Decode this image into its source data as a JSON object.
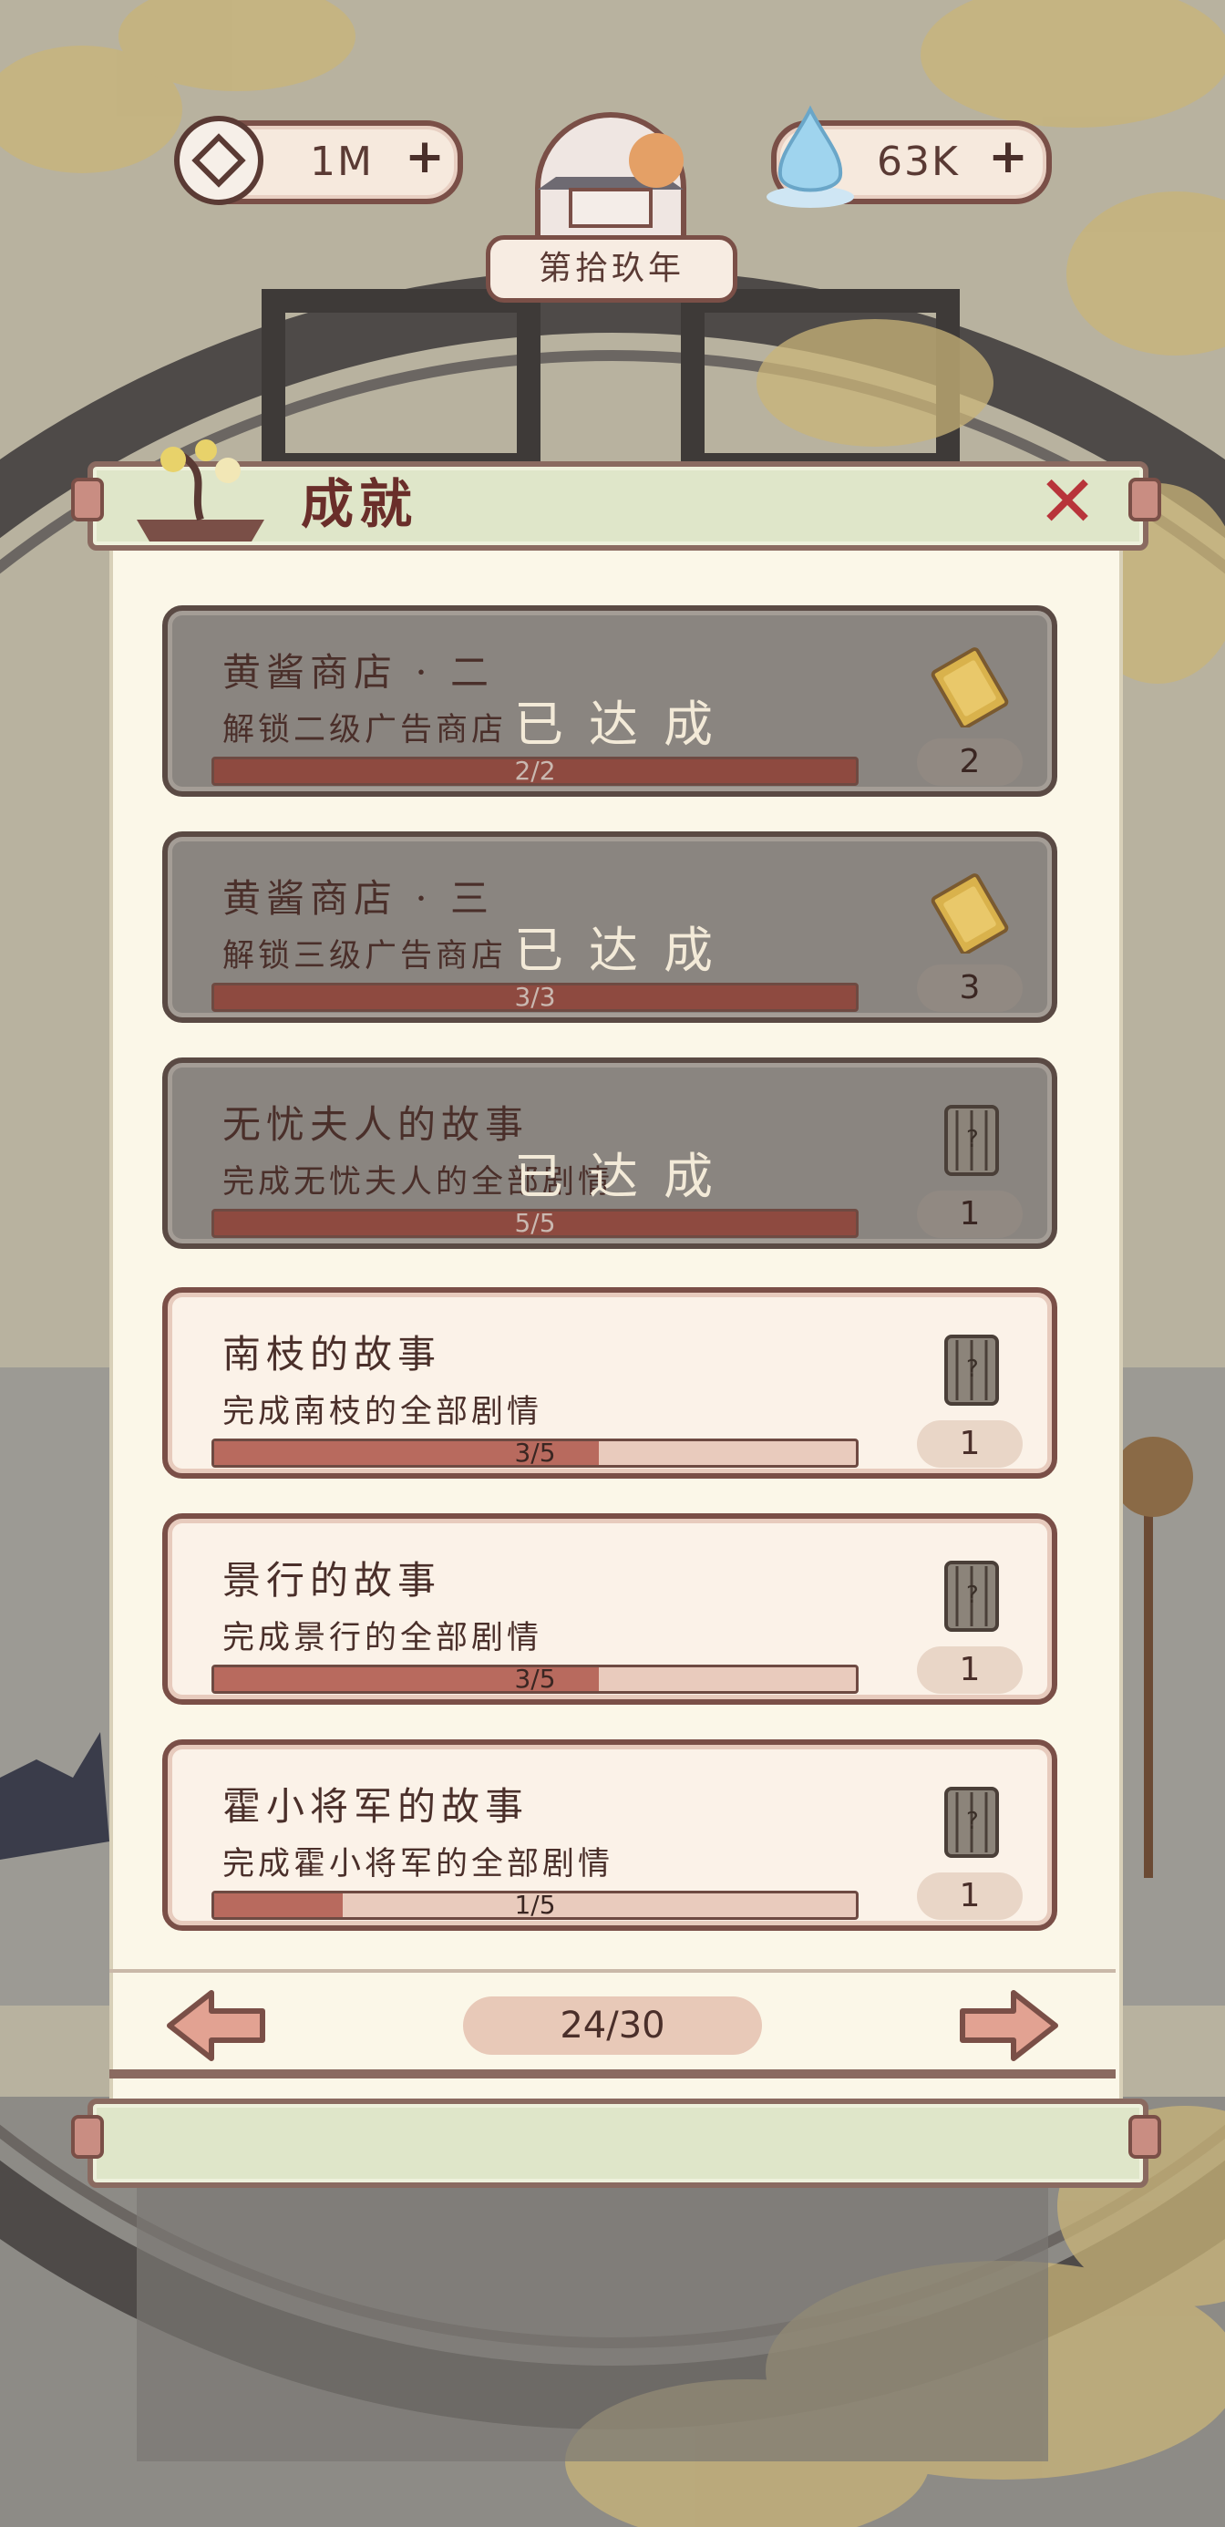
{
  "hud": {
    "coins": "1M",
    "water": "63K",
    "year": "第拾玖年"
  },
  "panel": {
    "title": "成就"
  },
  "achievements": [
    {
      "name": "黄酱商店 · 二",
      "desc": "解锁二级广告商店",
      "progress": "2/2",
      "fraction": 1.0,
      "completed": true,
      "completed_label": "已达成",
      "reward_icon": "ticket-icon",
      "reward": "2"
    },
    {
      "name": "黄酱商店 · 三",
      "desc": "解锁三级广告商店",
      "progress": "3/3",
      "fraction": 1.0,
      "completed": true,
      "completed_label": "已达成",
      "reward_icon": "ticket-icon",
      "reward": "3"
    },
    {
      "name": "无忧夫人的故事",
      "desc": "完成无忧夫人的全部剧情",
      "progress": "5/5",
      "fraction": 1.0,
      "completed": true,
      "completed_label": "已达成",
      "reward_icon": "scroll-icon",
      "reward": "1"
    },
    {
      "name": "南枝的故事",
      "desc": "完成南枝的全部剧情",
      "progress": "3/5",
      "fraction": 0.6,
      "completed": false,
      "completed_label": "",
      "reward_icon": "scroll-icon",
      "reward": "1"
    },
    {
      "name": "景行的故事",
      "desc": "完成景行的全部剧情",
      "progress": "3/5",
      "fraction": 0.6,
      "completed": false,
      "completed_label": "",
      "reward_icon": "scroll-icon",
      "reward": "1"
    },
    {
      "name": "霍小将军的故事",
      "desc": "完成霍小将军的全部剧情",
      "progress": "1/5",
      "fraction": 0.2,
      "completed": false,
      "completed_label": "",
      "reward_icon": "scroll-icon",
      "reward": "1"
    }
  ],
  "pagination": {
    "page": "24/30"
  },
  "colors": {
    "panel_bg": "#fbf7e8",
    "card_border": "#7a4f47",
    "progress_fill": "#b86a5e",
    "close_red": "#b8343a"
  }
}
